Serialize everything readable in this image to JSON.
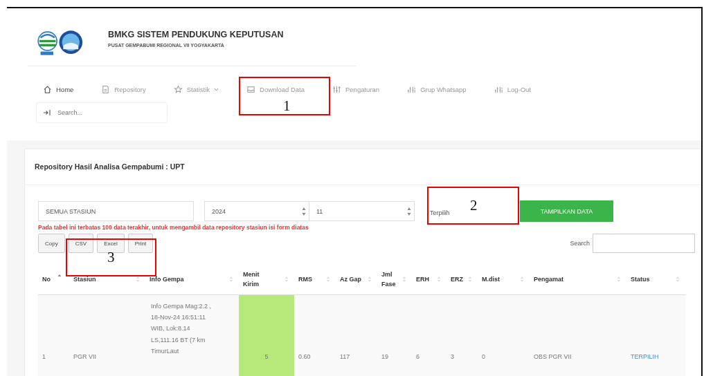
{
  "header": {
    "title": "BMKG SISTEM PENDUKUNG KEPUTUSAN",
    "subtitle": "PUSAT GEMPABUMI REGIONAL VII YOGYAKARTA"
  },
  "nav": [
    {
      "label": "Home",
      "dropdown": false,
      "active": true
    },
    {
      "label": "Repository",
      "dropdown": false,
      "active": false
    },
    {
      "label": "Statistik",
      "dropdown": true,
      "active": false
    },
    {
      "label": "Download Data",
      "dropdown": false,
      "active": false
    },
    {
      "label": "Pengaturan",
      "dropdown": false,
      "active": false
    },
    {
      "label": "Grup Whatsapp",
      "dropdown": false,
      "active": false
    },
    {
      "label": "Log-Out",
      "dropdown": false,
      "active": false
    }
  ],
  "search": {
    "placeholder": "Search..."
  },
  "card": {
    "title": "Repository Hasil Analisa Gempabumi : UPT"
  },
  "form": {
    "station": "SEMUA STASIUN",
    "year": "2024",
    "month": "11",
    "status": "Terpilih",
    "submit": "TAMPILKAN DATA"
  },
  "notice": "Pada tabel ini terbatas 100 data terakhir, untuk mengambil data repository stasiun isi form diatas",
  "export_buttons": [
    "Copy",
    "CSV",
    "Excel",
    "Print"
  ],
  "table_search": {
    "label": "Search"
  },
  "table": {
    "columns": [
      {
        "label": "No",
        "sorted": true
      },
      {
        "label": "Stasiun",
        "sorted": false
      },
      {
        "label": "Info Gempa",
        "sorted": false
      },
      {
        "label": "Menit Kirim",
        "sorted": false
      },
      {
        "label": "RMS",
        "sorted": false
      },
      {
        "label": "Az Gap",
        "sorted": false
      },
      {
        "label": "Jml Fase",
        "sorted": false
      },
      {
        "label": "ERH",
        "sorted": false
      },
      {
        "label": "ERZ",
        "sorted": false
      },
      {
        "label": "M.dist",
        "sorted": false
      },
      {
        "label": "Pengamat",
        "sorted": false
      },
      {
        "label": "Status",
        "sorted": false
      }
    ],
    "rows": [
      {
        "cells": [
          "1",
          "PGR VII",
          "Info Gempa Mag:2.2 , 18-Nov-24 16:51:11 WIB, Lok:8.14 LS,111.16 BT (7 km TimurLaut",
          "5",
          "0.60",
          "117",
          "19",
          "6",
          "3",
          "0",
          "OBS PGR VII",
          "TERPILIH"
        ]
      }
    ]
  },
  "annotations": [
    {
      "label": "1"
    },
    {
      "label": "2"
    },
    {
      "label": "3"
    }
  ]
}
